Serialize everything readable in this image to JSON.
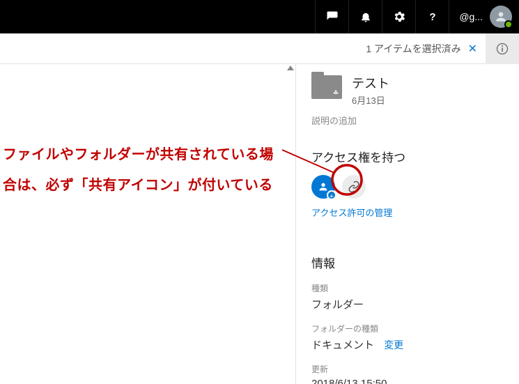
{
  "topbar": {
    "account_label": "@g...",
    "icons": {
      "chat": "chat-icon",
      "bell": "bell-icon",
      "gear": "gear-icon",
      "help": "help-icon"
    }
  },
  "selection_strip": {
    "text": "1 アイテムを選択済み"
  },
  "annotation": {
    "text": "ファイルやフォルダーが共有されている場合は、必ず「共有アイコン」が付いている"
  },
  "details": {
    "item": {
      "name": "テスト",
      "date": "6月13日"
    },
    "add_description": "説明の追加",
    "access": {
      "heading": "アクセス権を持つ",
      "manage_link": "アクセス許可の管理"
    },
    "info": {
      "heading": "情報",
      "type_label": "種類",
      "type_value": "フォルダー",
      "folder_type_label": "フォルダーの種類",
      "folder_type_value": "ドキュメント",
      "change_label": "変更",
      "updated_label": "更新",
      "updated_value": "2018/6/13 15:50"
    }
  }
}
